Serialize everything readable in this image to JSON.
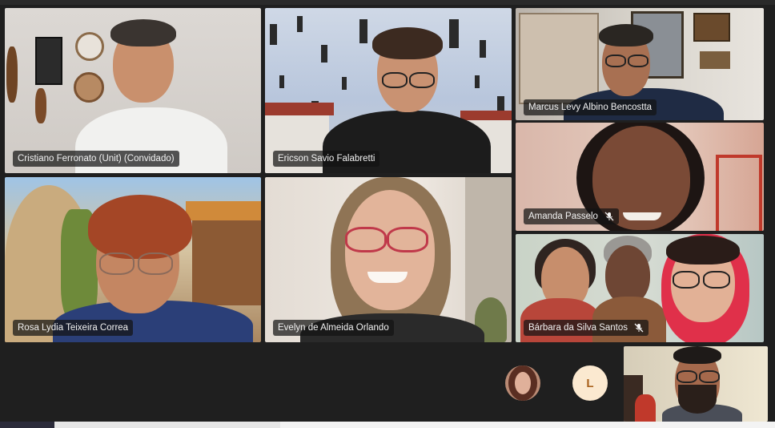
{
  "participants": [
    {
      "name": "Cristiano Ferronato (Unit) (Convidado)",
      "muted": false
    },
    {
      "name": "Ericson Savio Falabretti",
      "muted": false
    },
    {
      "name": "Marcus Levy Albino Bencostta",
      "muted": false
    },
    {
      "name": "Amanda Passelo",
      "muted": true
    },
    {
      "name": "Rosa Lydia Teixeira Correa",
      "muted": false
    },
    {
      "name": "Evelyn de Almeida Orlando",
      "muted": false
    },
    {
      "name": "Bárbara da Silva Santos",
      "muted": true
    }
  ],
  "overflow": {
    "avatar_letter": "L"
  },
  "icons": {
    "mic_off": "microphone-off-icon"
  },
  "colors": {
    "background": "#1f1f1f",
    "name_tag_bg": "#141414",
    "letter_avatar_bg": "#fbe9d0",
    "letter_avatar_fg": "#a9621d"
  }
}
